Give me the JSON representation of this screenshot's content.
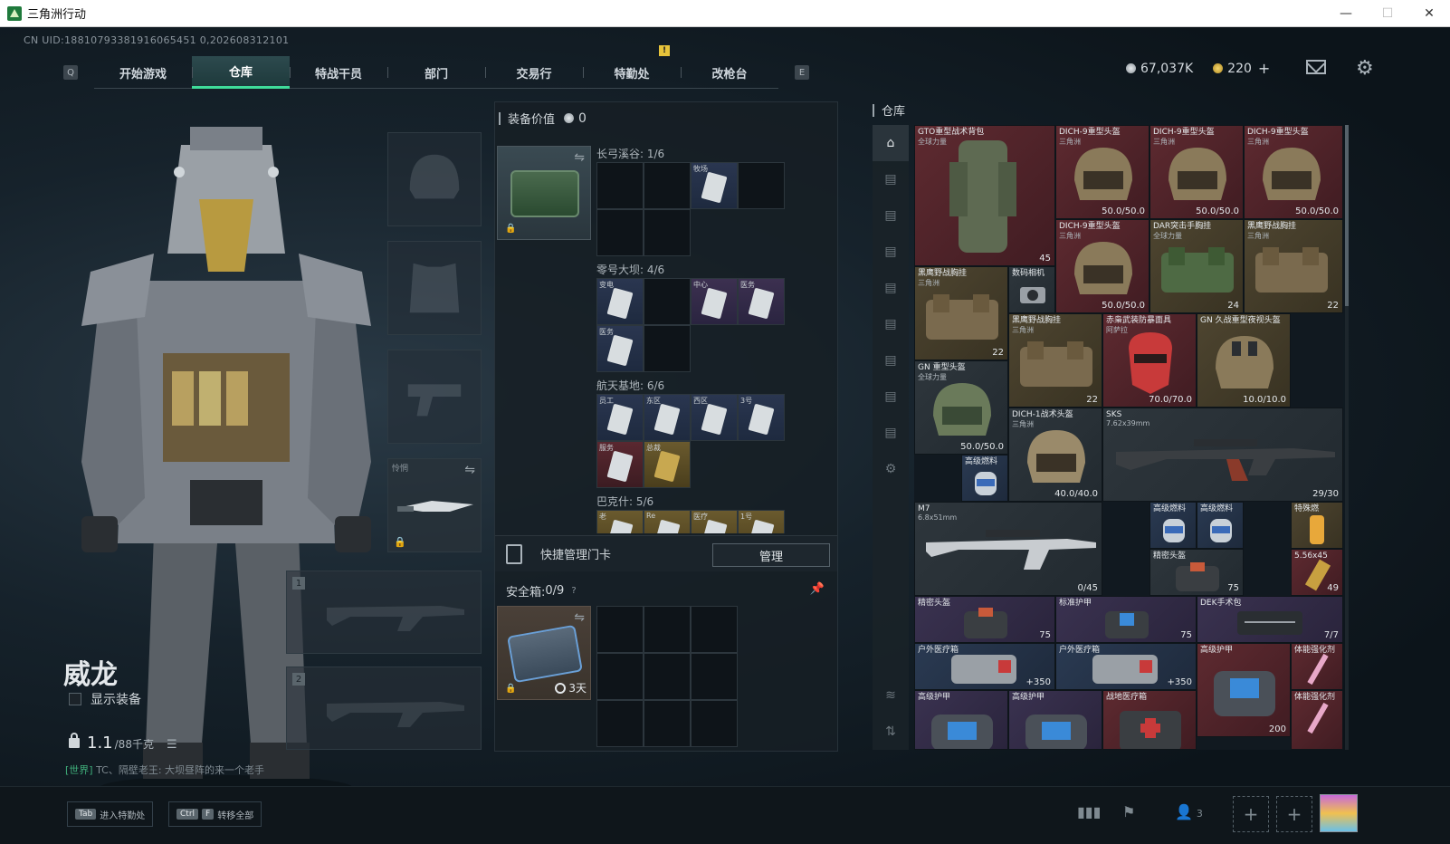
{
  "window": {
    "title": "三角洲行动"
  },
  "uid": "CN UID:18810793381916065451 0,202608312101",
  "nav": {
    "left_key": "Q",
    "right_key": "E",
    "badge": "!",
    "tabs": [
      "开始游戏",
      "仓库",
      "特战干员",
      "部门",
      "交易行",
      "特勤处",
      "改枪台"
    ],
    "active": 1
  },
  "currency": {
    "silver": "67,037K",
    "gold": "220",
    "plus": "+"
  },
  "character": {
    "name": "威龙",
    "show_gear": "显示装备",
    "weight": "1.1",
    "weight_max": "/88千克"
  },
  "chat": {
    "channel": "[世界]",
    "text": " TC、隔壁老王: 大坝昼阵的来一个老手"
  },
  "slots": {
    "melee_label": "怜惘",
    "weapon1": "1",
    "weapon2": "2"
  },
  "mid": {
    "header": "装备价值",
    "value": "0",
    "areas": [
      {
        "title": "长弓溪谷: 1/6"
      },
      {
        "title": "零号大坝: 4/6"
      },
      {
        "title": "航天基地: 6/6"
      },
      {
        "title": "巴克什: 5/6"
      }
    ],
    "tags_a1": [
      "牧场"
    ],
    "tags_a2": [
      "变电",
      "中心",
      "医务",
      "医务"
    ],
    "tags_a3": [
      "员工",
      "东区",
      "西区",
      "3号",
      "服务",
      "总裁"
    ],
    "tags_a4": [
      "老",
      "Re",
      "医疗",
      "1号"
    ],
    "quick_label": "快捷管理门卡",
    "manage_btn": "管理",
    "safe_label": "安全箱: ",
    "safe_count": "0/9",
    "safe_help": "?",
    "safe_time": "3天"
  },
  "warehouse": {
    "title": "仓库",
    "items": [
      {
        "name": "GTO重型战术背包",
        "sub": "全球力量",
        "cnt": "45"
      },
      {
        "name": "DICH-9重型头盔",
        "sub": "三角洲",
        "dur": "50.0/50.0"
      },
      {
        "name": "DICH-9重型头盔",
        "sub": "三角洲",
        "dur": "50.0/50.0"
      },
      {
        "name": "DICH-9重型头盔",
        "sub": "三角洲",
        "dur": "50.0/50.0"
      },
      {
        "name": "DICH-9重型头盔",
        "sub": "三角洲",
        "dur": "50.0/50.0"
      },
      {
        "name": "DAR突击手胸挂",
        "sub": "全球力量",
        "cnt": "24"
      },
      {
        "name": "黑鹰野战胸挂",
        "sub": "三角洲",
        "cnt": "22"
      },
      {
        "name": "黑鹰野战胸挂",
        "sub": "三角洲",
        "cnt": "22"
      },
      {
        "name": "数码相机",
        "sub": ""
      },
      {
        "name": "黑鹰野战胸挂",
        "sub": "三角洲",
        "cnt": "22"
      },
      {
        "name": "赤枭武装防暴面具",
        "sub": "阿萨拉",
        "dur": "70.0/70.0"
      },
      {
        "name": "GN 久战重型夜视头盔",
        "sub": "",
        "dur": "10.0/10.0"
      },
      {
        "name": "GN 重型头盔",
        "sub": "全球力量",
        "dur": "50.0/50.0"
      },
      {
        "name": "DICH-1战术头盔",
        "sub": "三角洲",
        "dur": "40.0/40.0"
      },
      {
        "name": "SKS",
        "sub": "7.62x39mm",
        "cnt": "29/30"
      },
      {
        "name": "高级燃料",
        "sub": ""
      },
      {
        "name": "M7",
        "sub": "6.8x51mm",
        "cnt": "0/45"
      },
      {
        "name": "高级燃料",
        "sub": ""
      },
      {
        "name": "高级燃料",
        "sub": ""
      },
      {
        "name": "特殊燃",
        "sub": ""
      },
      {
        "name": "精密头盔",
        "sub": "",
        "cnt": "75"
      },
      {
        "name": "5.56x45",
        "sub": "",
        "cnt": "49"
      },
      {
        "name": "精密头盔",
        "sub": "",
        "cnt": "75"
      },
      {
        "name": "标准护甲",
        "sub": "",
        "cnt": "75"
      },
      {
        "name": "DEK手术包",
        "sub": "",
        "cnt": "7/7"
      },
      {
        "name": "户外医疗箱",
        "sub": "",
        "cnt": "+350"
      },
      {
        "name": "户外医疗箱",
        "sub": "",
        "cnt": "+350"
      },
      {
        "name": "高级护甲",
        "sub": "",
        "cnt": "200"
      },
      {
        "name": "体能强化剂",
        "sub": ""
      },
      {
        "name": "高级护甲",
        "sub": ""
      },
      {
        "name": "高级护甲",
        "sub": ""
      },
      {
        "name": "战地医疗箱",
        "sub": ""
      },
      {
        "name": "体能强化剂",
        "sub": ""
      }
    ]
  },
  "bottom": {
    "hint1_key": "Tab",
    "hint1_text": "进入特勤处",
    "hint2_key1": "Ctrl",
    "hint2_key2": "F",
    "hint2_text": "转移全部",
    "team_count": "3"
  },
  "colors": {
    "accent": "#3fdc9a",
    "red_tier": "#5e2a30",
    "gold_tier": "#4e4530",
    "purple_tier": "#3a3250",
    "blue_tier": "#2a3a52"
  }
}
